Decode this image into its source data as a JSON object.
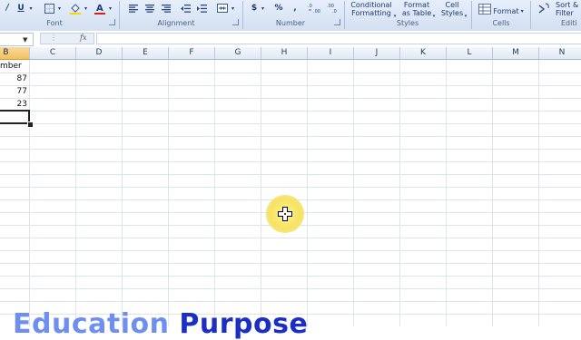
{
  "ribbon": {
    "groups": {
      "font": "Font",
      "alignment": "Alignment",
      "number": "Number",
      "styles": "Styles",
      "cells": "Cells",
      "editing": "Editi"
    },
    "font_buttons": {
      "underline": "U"
    },
    "number_buttons": {
      "currency": "$",
      "percent": "%",
      "comma": ","
    },
    "styles_buttons": {
      "conditional_formatting": [
        "Conditional",
        "Formatting"
      ],
      "format_as_table": [
        "Format",
        "as Table"
      ],
      "cell_styles": [
        "Cell",
        "Styles"
      ]
    },
    "cells_buttons": {
      "format": "Format"
    },
    "editing_buttons": {
      "sort_filter": [
        "Sort &",
        "Filter"
      ]
    },
    "icons": {
      "italic": "italic-icon",
      "underline": "underline-icon",
      "borders": "borders-icon",
      "fill_color": "fill-color-icon",
      "font_color": "font-color-icon",
      "align": "align-icon",
      "indent": "indent-icon",
      "merge": "merge-center-icon",
      "decimal": "decimal-icon",
      "sum": "autosum-icon"
    },
    "accent_colors": {
      "font_color_bar": "#d21e1e",
      "fill_color_bar": "#ffd700"
    }
  },
  "formula_bar": {
    "fx": "fx",
    "value": ""
  },
  "columns": [
    "B",
    "C",
    "D",
    "E",
    "F",
    "G",
    "H",
    "I",
    "J",
    "K",
    "L",
    "M",
    "N"
  ],
  "selected_column": "B",
  "cells": {
    "header": "mber",
    "values": [
      "87",
      "77",
      "23"
    ]
  },
  "watermark": {
    "part1": "Education",
    "part2": " Purpose"
  },
  "colors": {
    "highlight": "#f6e264",
    "grid": "#dde4ee",
    "header_bg": "#e2e9f4",
    "selected_header_bg": "#f1c15f"
  }
}
